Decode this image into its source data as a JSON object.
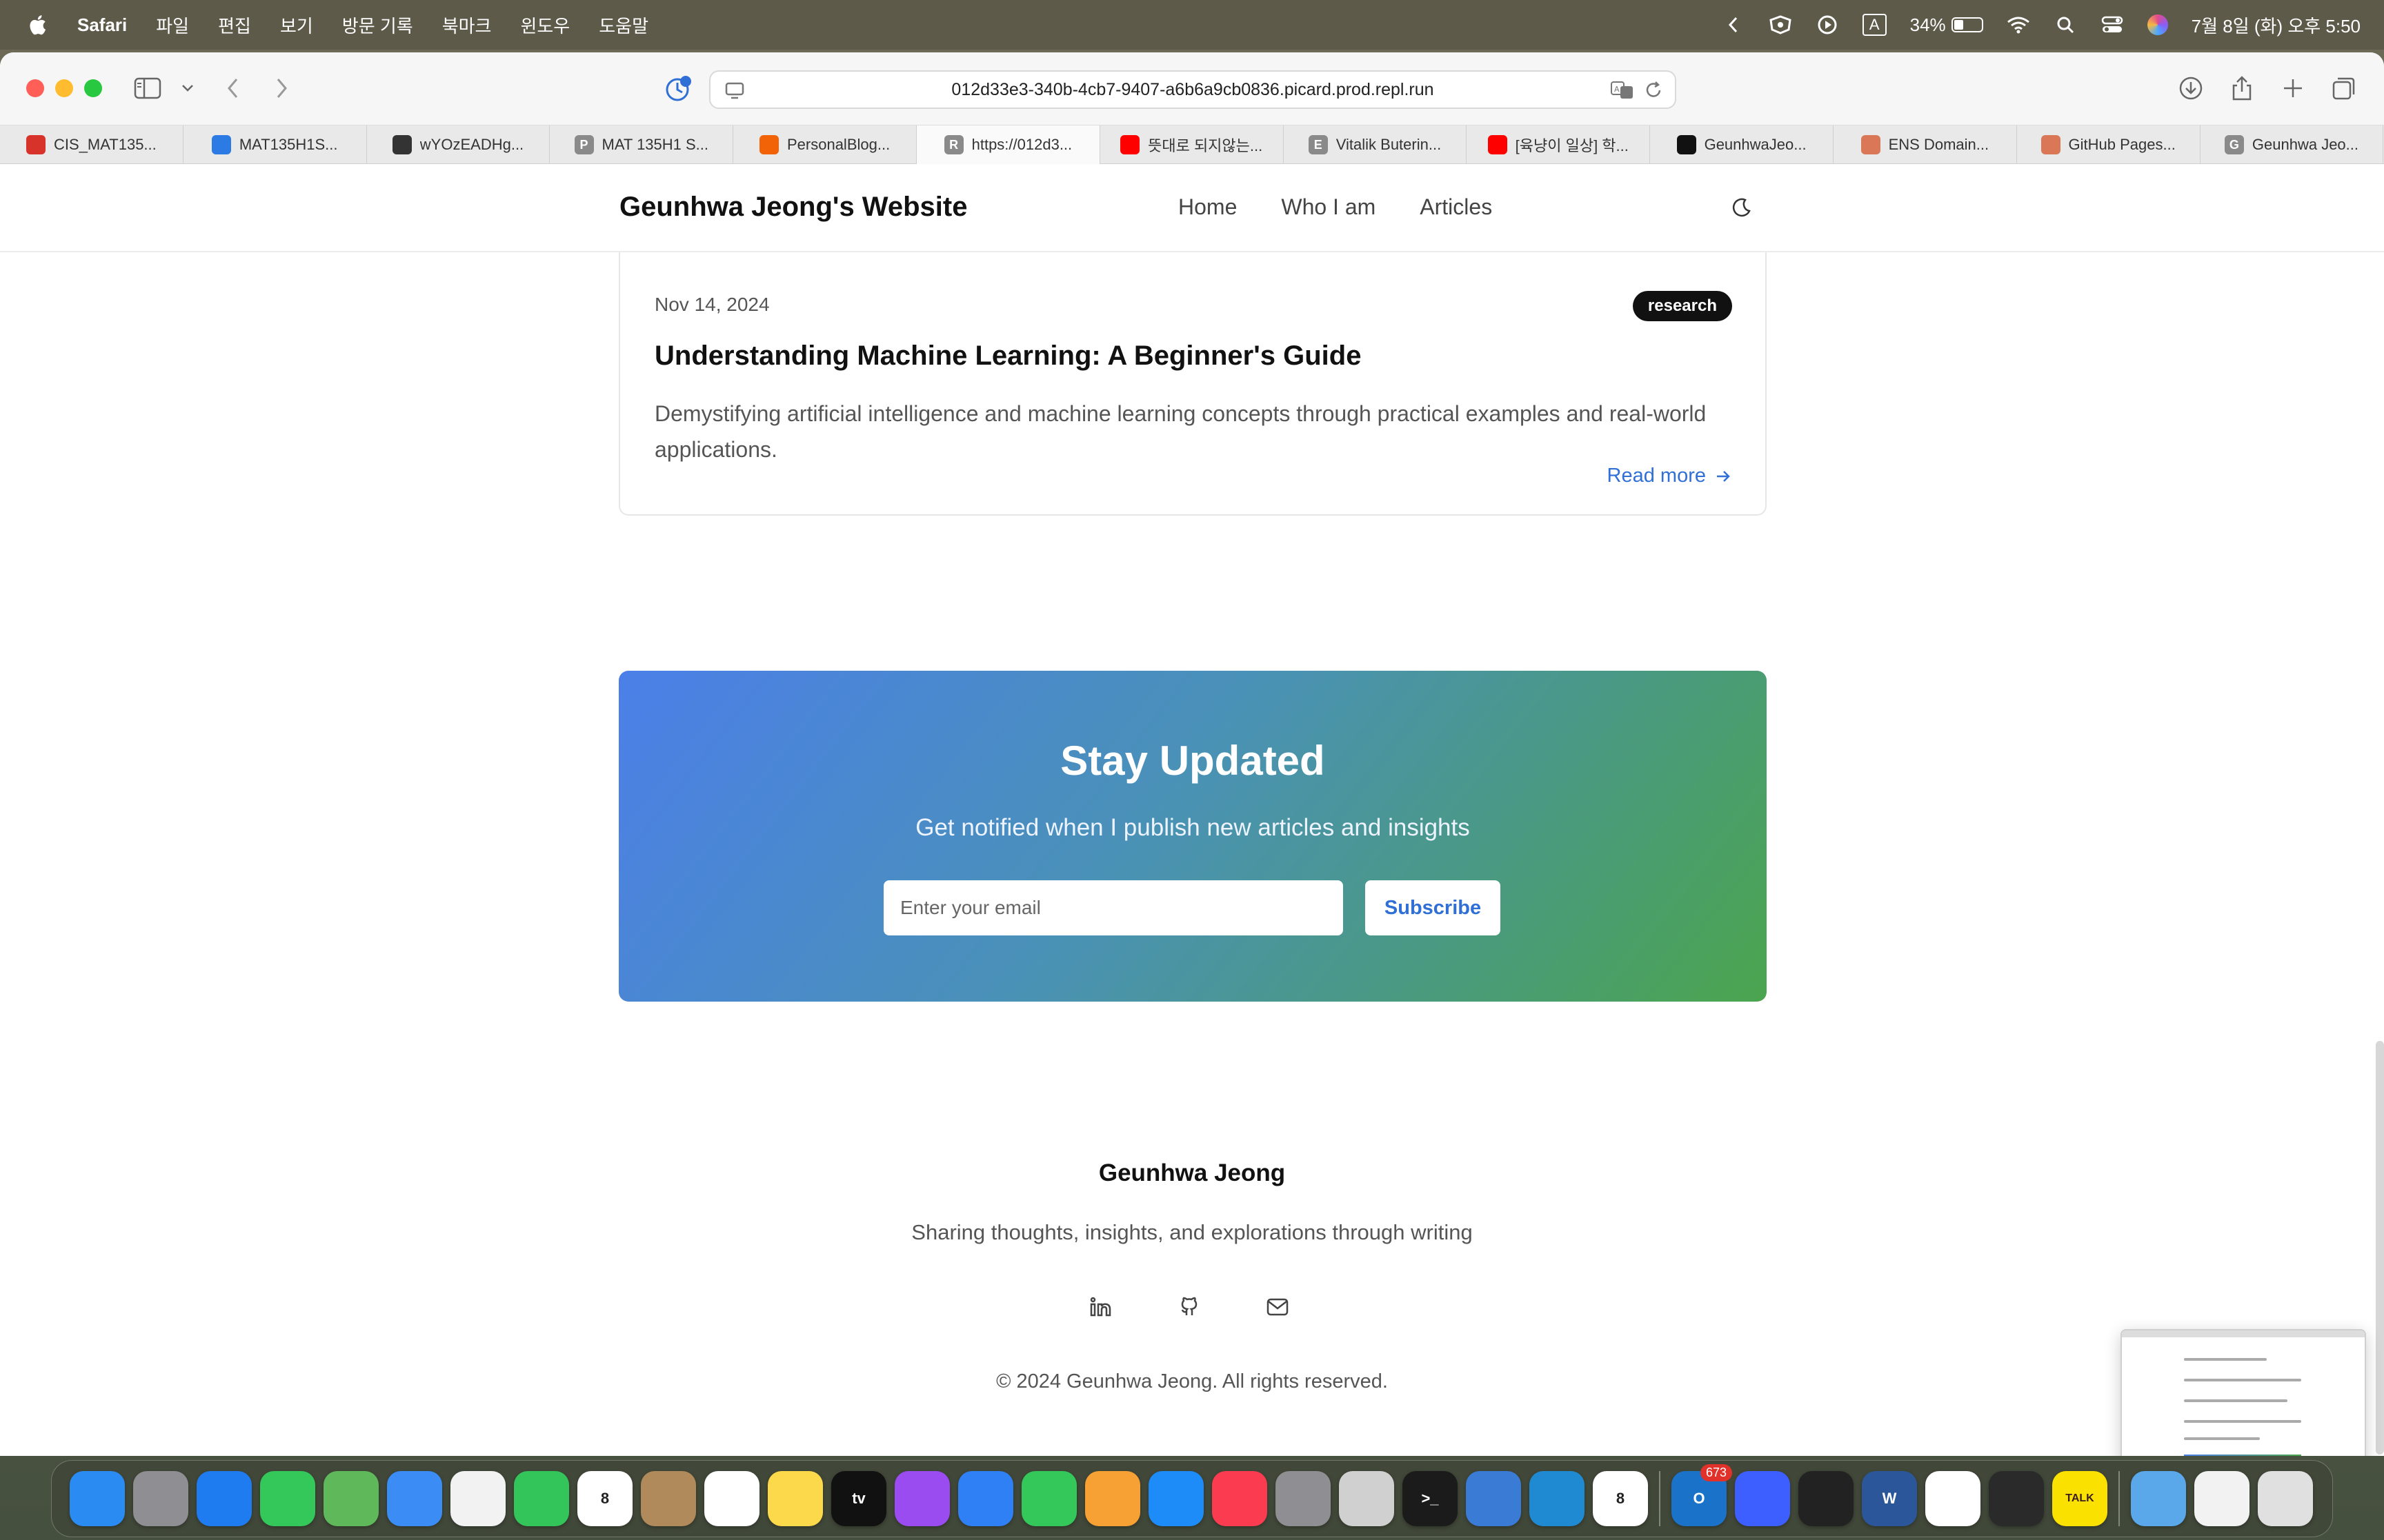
{
  "menubar": {
    "app_name": "Safari",
    "items": [
      "파일",
      "편집",
      "보기",
      "방문 기록",
      "북마크",
      "윈도우",
      "도움말"
    ],
    "battery_percent": "34%",
    "battery_level": 0.34,
    "input_indicator": "A",
    "datetime": "7월 8일 (화) 오후 5:50"
  },
  "browser": {
    "url": "012d33e3-340b-4cb7-9407-a6b6a9cb0836.picard.prod.repl.run",
    "tabs": [
      {
        "label": "CIS_MAT135...",
        "favicon": "gear-icon",
        "color": "#d8332a"
      },
      {
        "label": "MAT135H1S...",
        "favicon": "chart-icon",
        "color": "#2c7be5"
      },
      {
        "label": "wYOzEADHg...",
        "favicon": "monitor-icon",
        "color": "#333333"
      },
      {
        "label": "MAT 135H1 S...",
        "favicon": "letter-p-icon",
        "color": "#8a8a8a"
      },
      {
        "label": "PersonalBlog...",
        "favicon": "replit-icon",
        "color": "#f26207"
      },
      {
        "label": "https://012d3...",
        "favicon": "letter-r-icon",
        "color": "#8a8a8a",
        "active": true
      },
      {
        "label": "뜻대로 되지않는...",
        "favicon": "youtube-icon",
        "color": "#ff0000"
      },
      {
        "label": "Vitalik Buterin...",
        "favicon": "letter-e-icon",
        "color": "#8a8a8a"
      },
      {
        "label": "[육냥이 일상] 학...",
        "favicon": "youtube-icon",
        "color": "#ff0000"
      },
      {
        "label": "GeunhwaJeo...",
        "favicon": "github-icon",
        "color": "#111111"
      },
      {
        "label": "ENS Domain...",
        "favicon": "claude-icon",
        "color": "#d97757"
      },
      {
        "label": "GitHub Pages...",
        "favicon": "claude-icon",
        "color": "#d97757"
      },
      {
        "label": "Geunhwa Jeo...",
        "favicon": "letter-g-icon",
        "color": "#8a8a8a"
      }
    ]
  },
  "site": {
    "brand": "Geunhwa Jeong's Website",
    "nav": [
      "Home",
      "Who I am",
      "Articles"
    ]
  },
  "article": {
    "date": "Nov 14, 2024",
    "tag": "research",
    "title": "Understanding Machine Learning: A Beginner's Guide",
    "excerpt": "Demystifying artificial intelligence and machine learning concepts through practical examples and real-world applications.",
    "read_more": "Read more"
  },
  "newsletter": {
    "title": "Stay Updated",
    "subtitle": "Get notified when I publish new articles and insights",
    "email_placeholder": "Enter your email",
    "button": "Subscribe"
  },
  "footer": {
    "name": "Geunhwa Jeong",
    "tagline": "Sharing thoughts, insights, and explorations through writing",
    "socials": [
      "linkedin-icon",
      "github-icon",
      "mail-icon"
    ],
    "copyright": "© 2024 Geunhwa Jeong. All rights reserved."
  },
  "dock": {
    "apps": [
      {
        "name": "finder",
        "color": "#2a8bf2",
        "glyph": ""
      },
      {
        "name": "launchpad",
        "color": "#8e8e93",
        "glyph": ""
      },
      {
        "name": "safari",
        "color": "#1f7cf0",
        "glyph": ""
      },
      {
        "name": "messages",
        "color": "#34c759",
        "glyph": ""
      },
      {
        "name": "maps",
        "color": "#5fb85a",
        "glyph": ""
      },
      {
        "name": "mail",
        "color": "#3b8cf5",
        "glyph": ""
      },
      {
        "name": "photos",
        "color": "#f2f2f2",
        "glyph": ""
      },
      {
        "name": "facetime",
        "color": "#33c45a",
        "glyph": ""
      },
      {
        "name": "calendar",
        "color": "#ffffff",
        "glyph": "8"
      },
      {
        "name": "contacts",
        "color": "#b08a5a",
        "glyph": ""
      },
      {
        "name": "reminders",
        "color": "#ffffff",
        "glyph": ""
      },
      {
        "name": "notes",
        "color": "#fbd94a",
        "glyph": ""
      },
      {
        "name": "tv",
        "color": "#111111",
        "glyph": "tv"
      },
      {
        "name": "podcasts",
        "color": "#9b4cf0",
        "glyph": ""
      },
      {
        "name": "keynote",
        "color": "#2f7ff5",
        "glyph": ""
      },
      {
        "name": "numbers",
        "color": "#34c759",
        "glyph": ""
      },
      {
        "name": "pages",
        "color": "#f7a033",
        "glyph": ""
      },
      {
        "name": "app-store",
        "color": "#1d8cf8",
        "glyph": ""
      },
      {
        "name": "music",
        "color": "#fb3c50",
        "glyph": ""
      },
      {
        "name": "system-settings",
        "color": "#8e8e93",
        "glyph": ""
      },
      {
        "name": "iphone-mirroring",
        "color": "#d0d0d0",
        "glyph": ""
      },
      {
        "name": "terminal",
        "color": "#1b1b1b",
        "glyph": ">_"
      },
      {
        "name": "xcode",
        "color": "#3a7bd5",
        "glyph": ""
      },
      {
        "name": "vscode",
        "color": "#1f8ad2",
        "glyph": ""
      },
      {
        "name": "fantastical",
        "color": "#ffffff",
        "glyph": "8"
      },
      {
        "name": "outlook",
        "color": "#1a73c8",
        "glyph": "O",
        "badge": "673"
      },
      {
        "name": "nordvpn",
        "color": "#3e5fff",
        "glyph": ""
      },
      {
        "name": "unity",
        "color": "#222222",
        "glyph": ""
      },
      {
        "name": "word",
        "color": "#2b579a",
        "glyph": "W"
      },
      {
        "name": "chrome",
        "color": "#ffffff",
        "glyph": ""
      },
      {
        "name": "tailscale",
        "color": "#2a2a2a",
        "glyph": ""
      },
      {
        "name": "kakaotalk",
        "color": "#fae100",
        "glyph": "TALK"
      },
      {
        "name": "downloads-folder",
        "color": "#5aa7ea",
        "glyph": ""
      },
      {
        "name": "window-preview",
        "color": "#f2f2f2",
        "glyph": ""
      },
      {
        "name": "trash",
        "color": "#e0e0e0",
        "glyph": ""
      }
    ]
  }
}
